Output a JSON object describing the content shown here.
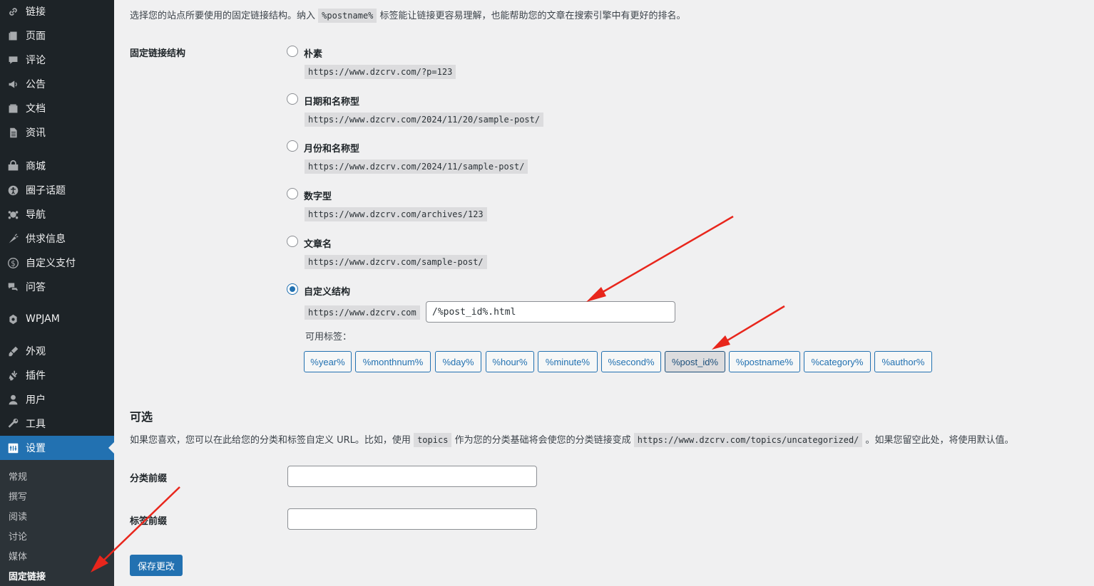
{
  "sidebar": {
    "items": [
      {
        "label": "链接",
        "icon": "link-icon"
      },
      {
        "label": "页面",
        "icon": "page-icon"
      },
      {
        "label": "评论",
        "icon": "comment-icon"
      },
      {
        "label": "公告",
        "icon": "megaphone-icon"
      },
      {
        "label": "文档",
        "icon": "document-icon"
      },
      {
        "label": "资讯",
        "icon": "news-icon"
      },
      {
        "label": "商城",
        "icon": "shop-icon"
      },
      {
        "label": "圈子话题",
        "icon": "universal-access-icon"
      },
      {
        "label": "导航",
        "icon": "navigation-icon"
      },
      {
        "label": "供求信息",
        "icon": "carrot-icon"
      },
      {
        "label": "自定义支付",
        "icon": "dollar-icon"
      },
      {
        "label": "问答",
        "icon": "qa-icon"
      },
      {
        "label": "WPJAM",
        "icon": "wpjam-icon"
      },
      {
        "label": "外观",
        "icon": "appearance-icon"
      },
      {
        "label": "插件",
        "icon": "plugin-icon"
      },
      {
        "label": "用户",
        "icon": "user-icon"
      },
      {
        "label": "工具",
        "icon": "tools-icon"
      },
      {
        "label": "设置",
        "icon": "settings-icon"
      }
    ],
    "submenu": [
      "常规",
      "撰写",
      "阅读",
      "讨论",
      "媒体",
      "固定链接"
    ]
  },
  "intro": {
    "before": "选择您的站点所要使用的固定链接结构。纳入",
    "code": "%postname%",
    "after": "标签能让链接更容易理解，也能帮助您的文章在搜索引擎中有更好的排名。"
  },
  "structure": {
    "label": "固定链接结构",
    "options": [
      {
        "label": "朴素",
        "example": "https://www.dzcrv.com/?p=123"
      },
      {
        "label": "日期和名称型",
        "example": "https://www.dzcrv.com/2024/11/20/sample-post/"
      },
      {
        "label": "月份和名称型",
        "example": "https://www.dzcrv.com/2024/11/sample-post/"
      },
      {
        "label": "数字型",
        "example": "https://www.dzcrv.com/archives/123"
      },
      {
        "label": "文章名",
        "example": "https://www.dzcrv.com/sample-post/"
      },
      {
        "label": "自定义结构",
        "example": "https://www.dzcrv.com"
      }
    ],
    "custom_value": "/%post_id%.html",
    "tags_label": "可用标签：",
    "tags": [
      "%year%",
      "%monthnum%",
      "%day%",
      "%hour%",
      "%minute%",
      "%second%",
      "%post_id%",
      "%postname%",
      "%category%",
      "%author%"
    ]
  },
  "optional": {
    "title": "可选",
    "desc_before": "如果您喜欢，您可以在此给您的分类和标签自定义 URL。比如，使用",
    "desc_code1": "topics",
    "desc_middle": "作为您的分类基础将会使您的分类链接变成",
    "desc_code2": "https://www.dzcrv.com/topics/uncategorized/",
    "desc_after": "。如果您留空此处，将使用默认值。",
    "category_label": "分类前缀",
    "tag_label": "标签前缀",
    "category_value": "",
    "tag_value": ""
  },
  "save_label": "保存更改",
  "colors": {
    "accent": "#2271b1",
    "sidebar": "#1d2327",
    "arrow": "#e8261c"
  }
}
